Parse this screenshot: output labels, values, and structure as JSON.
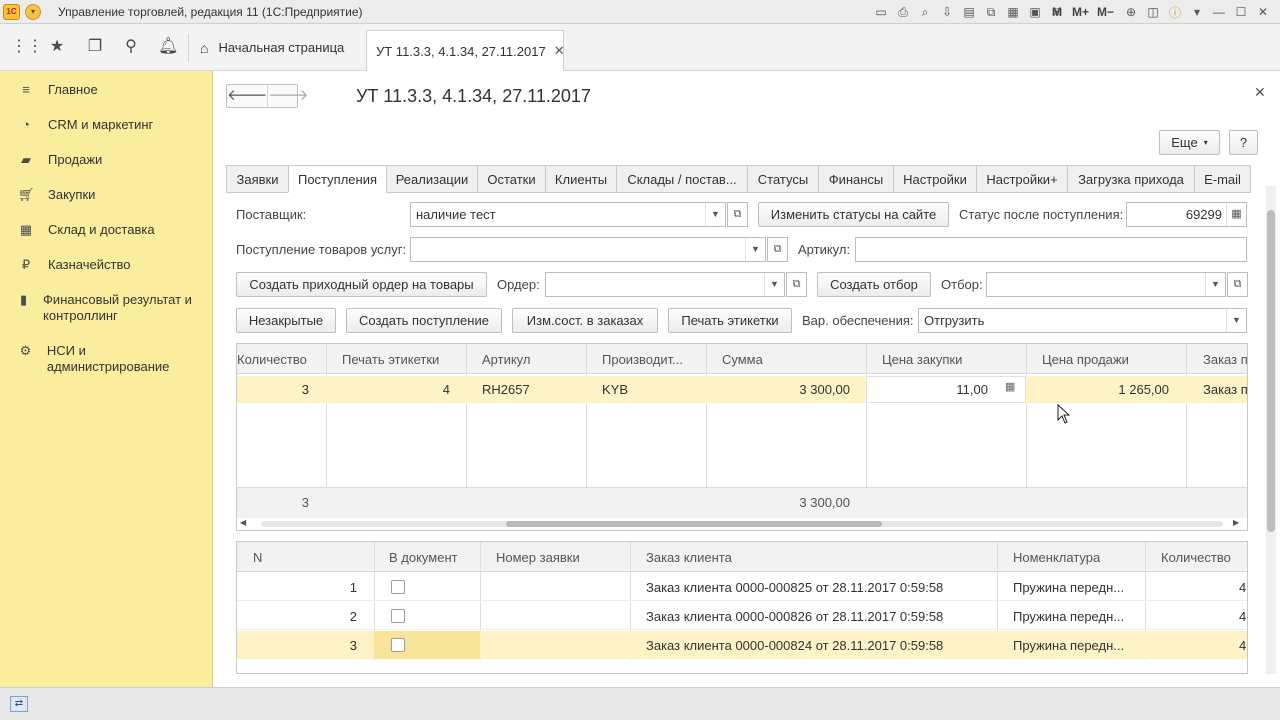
{
  "window": {
    "title": "Управление торговлей, редакция 11  (1С:Предприятие)",
    "logo": "1С"
  },
  "titlebar_icons": [
    "М",
    "М+",
    "М−"
  ],
  "tabs_bar": {
    "home_label": "Начальная страница",
    "doc_tab_label": "УТ 11.3.3, 4.1.34, 27.11.2017"
  },
  "sidebar": {
    "items": [
      {
        "label": "Главное",
        "icon": "menu-icon"
      },
      {
        "label": "CRM и маркетинг",
        "icon": "crm-icon"
      },
      {
        "label": "Продажи",
        "icon": "sales-icon"
      },
      {
        "label": "Закупки",
        "icon": "cart-icon"
      },
      {
        "label": "Склад и доставка",
        "icon": "warehouse-icon"
      },
      {
        "label": "Казначейство",
        "icon": "ruble-icon"
      },
      {
        "label": "Финансовый результат и контроллинг",
        "icon": "chart-icon"
      },
      {
        "label": "НСИ и администрирование",
        "icon": "gear-icon"
      }
    ]
  },
  "form": {
    "title": "УТ 11.3.3, 4.1.34, 27.11.2017",
    "more_button": "Еще",
    "help_button": "?",
    "tabs": [
      "Заявки",
      "Поступления",
      "Реализации",
      "Остатки",
      "Клиенты",
      "Склады / постав...",
      "Статусы",
      "Финансы",
      "Настройки",
      "Настройки+",
      "Загрузка прихода",
      "E-mail"
    ],
    "active_tab": 1,
    "supplier_label": "Поставщик:",
    "supplier_value": "наличие тест",
    "change_status_button": "Изменить статусы на сайте",
    "status_after_label": "Статус после поступления:",
    "status_after_value": "69299",
    "receipt_label": "Поступление товаров услуг:",
    "receipt_value": "",
    "article_label": "Артикул:",
    "article_value": "",
    "create_order_button": "Создать приходный ордер на товары",
    "order_label": "Ордер:",
    "order_value": "",
    "create_filter_button": "Создать отбор",
    "filter_label": "Отбор:",
    "filter_value": "",
    "unclosed_button": "Незакрытые",
    "create_receipt_button": "Создать поступление",
    "change_state_button": "Изм.сост. в заказах",
    "print_labels_button": "Печать этикетки",
    "provision_label": "Вар. обеспечения:",
    "provision_value": "Отгрузить"
  },
  "top_grid": {
    "columns": [
      "Количество",
      "Печать этикетки",
      "Артикул",
      "Производит...",
      "Сумма",
      "Цена закупки",
      "Цена продажи",
      "Заказ п"
    ],
    "rows": [
      {
        "qty": "3",
        "print": "4",
        "article": "RH2657",
        "maker": "KYB",
        "sum": "3 300,00",
        "buy_price": "11,00",
        "sell_price": "1 265,00",
        "order": "Заказ п"
      }
    ],
    "totals": {
      "qty": "3",
      "sum": "3 300,00"
    }
  },
  "bottom_grid": {
    "columns": [
      "N",
      "В документ",
      "Номер заявки",
      "Заказ клиента",
      "Номенклатура",
      "Количество"
    ],
    "rows": [
      {
        "n": "1",
        "order": "Заказ клиента 0000-000825 от 28.11.2017 0:59:58",
        "item": "Пружина передн...",
        "qty": "4"
      },
      {
        "n": "2",
        "order": "Заказ клиента 0000-000826 от 28.11.2017 0:59:58",
        "item": "Пружина передн...",
        "qty": "4"
      },
      {
        "n": "3",
        "order": "Заказ клиента 0000-000824 от 28.11.2017 0:59:58",
        "item": "Пружина передн...",
        "qty": "4"
      }
    ]
  },
  "colors": {
    "sidebar": "#fbed9e",
    "selected_row": "#fdf3c6",
    "accent": "#f5c23b"
  }
}
